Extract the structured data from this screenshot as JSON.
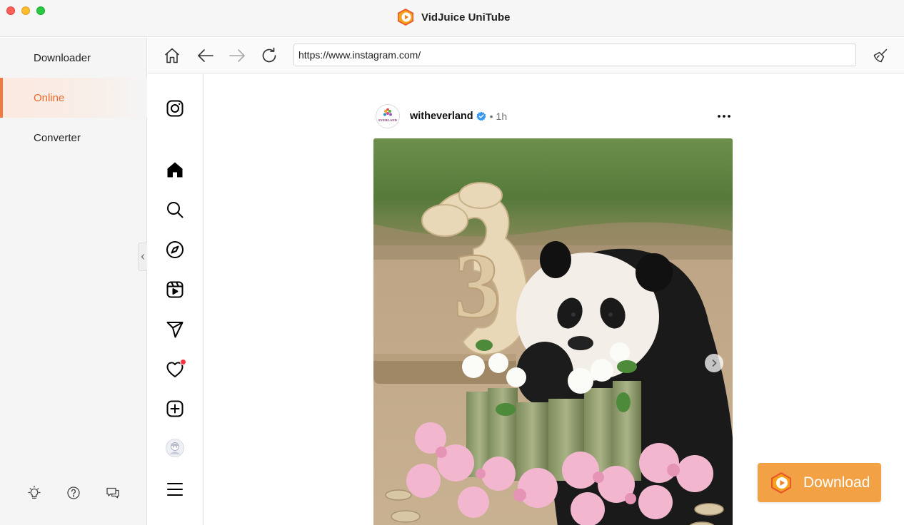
{
  "app": {
    "title": "VidJuice UniTube",
    "brand_color": "#ee7a44"
  },
  "sidebar": {
    "items": [
      {
        "label": "Downloader",
        "active": false
      },
      {
        "label": "Online",
        "active": true
      },
      {
        "label": "Converter",
        "active": false
      }
    ],
    "bottom_icons": [
      "lightbulb-icon",
      "help-icon",
      "feedback-icon"
    ]
  },
  "toolbar": {
    "buttons": [
      "home-icon",
      "back-icon",
      "forward-icon",
      "reload-icon"
    ],
    "url": "https://www.instagram.com/",
    "clear_icon": "broom-icon"
  },
  "instagram": {
    "nav_icons": [
      "instagram-logo-icon",
      "home-icon",
      "search-icon",
      "explore-icon",
      "reels-icon",
      "messages-icon",
      "notifications-icon",
      "create-icon",
      "profile-avatar",
      "menu-icon"
    ],
    "notification_dot": true,
    "post": {
      "username": "witheverland",
      "verified": true,
      "separator": "•",
      "time": "1h",
      "avatar_text": "EVERLAND",
      "image_number": "3"
    }
  },
  "download": {
    "label": "Download",
    "color": "#f2a245"
  }
}
